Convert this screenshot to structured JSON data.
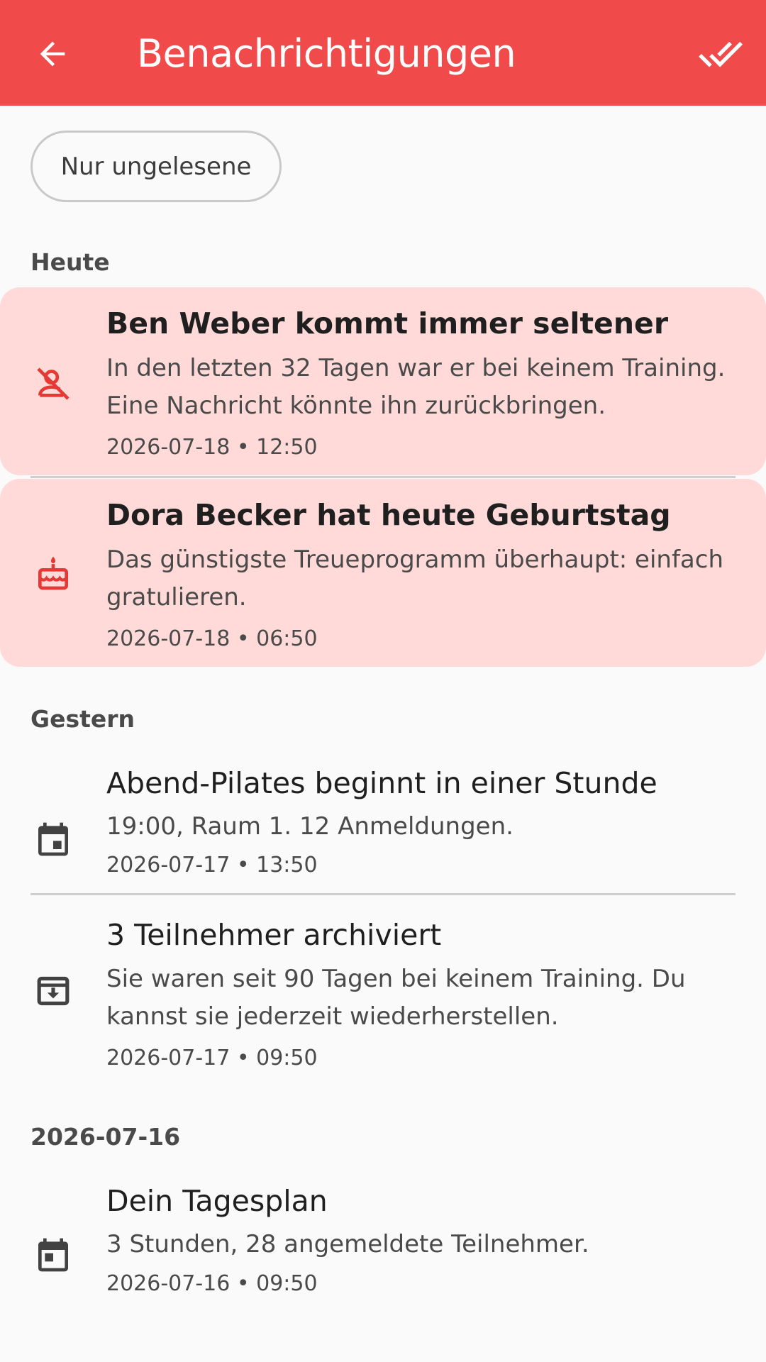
{
  "appbar": {
    "title": "Benachrichtigungen",
    "back_icon": "arrow-left-icon",
    "mark_all_icon": "double-check-icon",
    "background": "#f14a4a"
  },
  "filter": {
    "label": "Nur ungelesene"
  },
  "sections": [
    {
      "label": "Heute"
    },
    {
      "label": "Gestern"
    },
    {
      "label": "2026-07-16"
    }
  ],
  "notifications": [
    {
      "title": "Ben Weber kommt immer seltener",
      "body": "In den letzten 32 Tagen war er bei keinem Training. Eine Nachricht könnte ihn zurückbringen.",
      "time": "2026-07-18 • 12:50",
      "icon": "person-off-icon",
      "unread": true
    },
    {
      "title": "Dora Becker hat heute Geburtstag",
      "body": "Das günstigste Treueprogramm überhaupt: einfach gratulieren.",
      "time": "2026-07-18 • 06:50",
      "icon": "cake-icon",
      "unread": true
    },
    {
      "title": "Abend-Pilates beginnt in einer Stunde",
      "body": "19:00, Raum 1. 12 Anmeldungen.",
      "time": "2026-07-17 • 13:50",
      "icon": "calendar-event-icon",
      "unread": false
    },
    {
      "title": "3 Teilnehmer archiviert",
      "body": "Sie waren seit 90 Tagen bei keinem Training. Du kannst sie jederzeit wiederherstellen.",
      "time": "2026-07-17 • 09:50",
      "icon": "archive-icon",
      "unread": false
    },
    {
      "title": "Dein Tagesplan",
      "body": "3 Stunden, 28 angemeldete Teilnehmer.",
      "time": "2026-07-16 • 09:50",
      "icon": "calendar-event-icon",
      "unread": false
    }
  ],
  "colors": {
    "unread_bg": "#ffdad8",
    "accent": "#e53935",
    "icon_dark": "#424242"
  }
}
